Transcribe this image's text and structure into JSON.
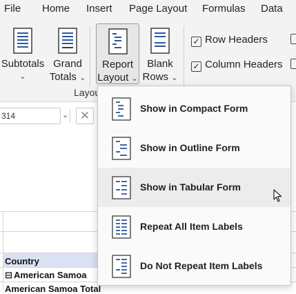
{
  "menubar": {
    "tabs": [
      "File",
      "Home",
      "Insert",
      "Page Layout",
      "Formulas",
      "Data"
    ]
  },
  "ribbon": {
    "subtotals": {
      "line1": "Subtotals",
      "chevron": "⌄"
    },
    "grand_totals": {
      "line1": "Grand",
      "line2": "Totals",
      "chevron": "⌄"
    },
    "report_layout": {
      "line1": "Report",
      "line2": "Layout",
      "chevron": "⌄"
    },
    "blank_rows": {
      "line1": "Blank",
      "line2": "Rows",
      "chevron": "⌄"
    },
    "group_label": "Layou",
    "row_headers": {
      "label": "Row Headers",
      "checked": true
    },
    "column_headers": {
      "label": "Column Headers",
      "checked": true
    }
  },
  "formula_bar": {
    "name_box": "314",
    "cancel_symbol": "✕"
  },
  "sheet": {
    "header_cell": "Country",
    "row1": "American Samoa",
    "row1_toggle": "⊟",
    "row2": "American Samoa Total"
  },
  "report_layout_menu": {
    "items": [
      {
        "label": "Show in Compact Form",
        "icon": "compact-form-icon"
      },
      {
        "label": "Show in Outline Form",
        "icon": "outline-form-icon"
      },
      {
        "label": "Show in Tabular Form",
        "icon": "tabular-form-icon"
      },
      {
        "label": "Repeat All Item Labels",
        "icon": "repeat-labels-icon"
      },
      {
        "label": "Do Not Repeat Item Labels",
        "icon": "no-repeat-labels-icon"
      }
    ]
  }
}
